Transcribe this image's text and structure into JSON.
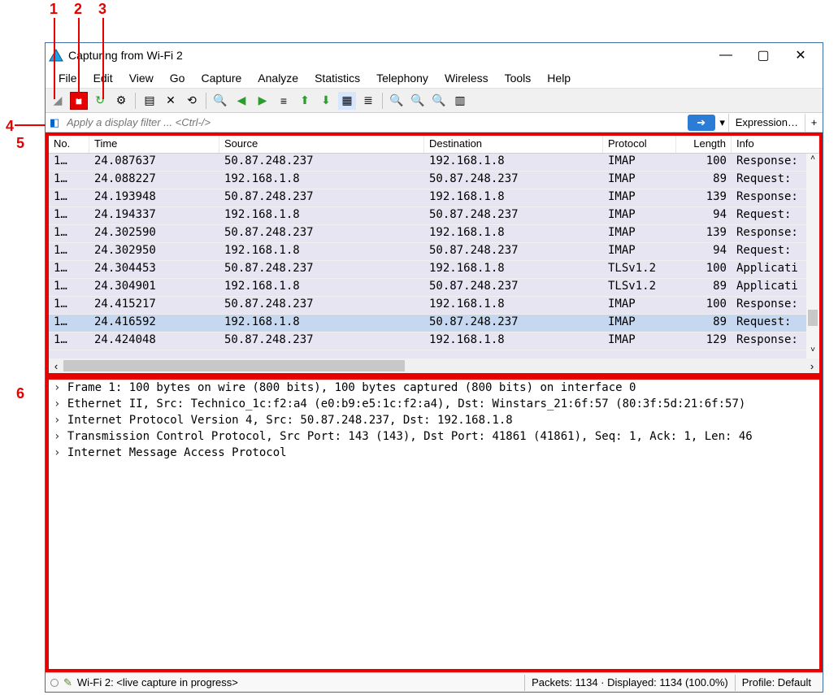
{
  "annotations": {
    "n1": "1",
    "n2": "2",
    "n3": "3",
    "n4": "4",
    "n5": "5",
    "n6": "6"
  },
  "window": {
    "title": "Capturing from Wi-Fi 2"
  },
  "win_controls": {
    "min": "—",
    "max": "▢",
    "close": "✕"
  },
  "menu": {
    "file": "File",
    "edit": "Edit",
    "view": "View",
    "go": "Go",
    "capture": "Capture",
    "analyze": "Analyze",
    "statistics": "Statistics",
    "telephony": "Telephony",
    "wireless": "Wireless",
    "tools": "Tools",
    "help": "Help"
  },
  "toolbar_icons": {
    "start": "◢",
    "stop": "■",
    "restart": "↻",
    "options": "⚙",
    "open": "▤",
    "save": "✕",
    "close": "⟲",
    "find": "🔍",
    "prev": "◀",
    "next": "▶",
    "jump": "≡",
    "first": "⬆",
    "last": "⬇",
    "autoscroll": "▦",
    "colorize": "≣",
    "zoomin": "🔍",
    "zoomout": "🔍",
    "zoomreset": "🔍",
    "resize": "▥"
  },
  "filter": {
    "placeholder": "Apply a display filter ... <Ctrl-/>",
    "apply_arrow": "➔",
    "dropdown": "▾",
    "expression": "Expression…",
    "plus": "+"
  },
  "pkt_headers": {
    "no": "No.",
    "time": "Time",
    "source": "Source",
    "destination": "Destination",
    "protocol": "Protocol",
    "length": "Length",
    "info": "Info"
  },
  "packets": [
    {
      "no": "1…",
      "time": "24.087637",
      "src": "50.87.248.237",
      "dst": "192.168.1.8",
      "proto": "IMAP",
      "len": "100",
      "info": "Response:"
    },
    {
      "no": "1…",
      "time": "24.088227",
      "src": "192.168.1.8",
      "dst": "50.87.248.237",
      "proto": "IMAP",
      "len": "89",
      "info": "Request:"
    },
    {
      "no": "1…",
      "time": "24.193948",
      "src": "50.87.248.237",
      "dst": "192.168.1.8",
      "proto": "IMAP",
      "len": "139",
      "info": "Response:"
    },
    {
      "no": "1…",
      "time": "24.194337",
      "src": "192.168.1.8",
      "dst": "50.87.248.237",
      "proto": "IMAP",
      "len": "94",
      "info": "Request:"
    },
    {
      "no": "1…",
      "time": "24.302590",
      "src": "50.87.248.237",
      "dst": "192.168.1.8",
      "proto": "IMAP",
      "len": "139",
      "info": "Response:"
    },
    {
      "no": "1…",
      "time": "24.302950",
      "src": "192.168.1.8",
      "dst": "50.87.248.237",
      "proto": "IMAP",
      "len": "94",
      "info": "Request:"
    },
    {
      "no": "1…",
      "time": "24.304453",
      "src": "50.87.248.237",
      "dst": "192.168.1.8",
      "proto": "TLSv1.2",
      "len": "100",
      "info": "Applicati"
    },
    {
      "no": "1…",
      "time": "24.304901",
      "src": "192.168.1.8",
      "dst": "50.87.248.237",
      "proto": "TLSv1.2",
      "len": "89",
      "info": "Applicati"
    },
    {
      "no": "1…",
      "time": "24.415217",
      "src": "50.87.248.237",
      "dst": "192.168.1.8",
      "proto": "IMAP",
      "len": "100",
      "info": "Response:"
    },
    {
      "no": "1…",
      "time": "24.416592",
      "src": "192.168.1.8",
      "dst": "50.87.248.237",
      "proto": "IMAP",
      "len": "89",
      "info": "Request:",
      "selected": true
    },
    {
      "no": "1…",
      "time": "24.424048",
      "src": "50.87.248.237",
      "dst": "192.168.1.8",
      "proto": "IMAP",
      "len": "129",
      "info": "Response:"
    }
  ],
  "scroll": {
    "left": "‹",
    "right": "›",
    "up": "˄",
    "down": "˅"
  },
  "details": [
    "Frame 1: 100 bytes on wire (800 bits), 100 bytes captured (800 bits) on interface 0",
    "Ethernet II, Src: Technico_1c:f2:a4 (e0:b9:e5:1c:f2:a4), Dst: Winstars_21:6f:57 (80:3f:5d:21:6f:57)",
    "Internet Protocol Version 4, Src: 50.87.248.237, Dst: 192.168.1.8",
    "Transmission Control Protocol, Src Port: 143 (143), Dst Port: 41861 (41861), Seq: 1, Ack: 1, Len: 46",
    "Internet Message Access Protocol"
  ],
  "status": {
    "edit_note": "✎",
    "iface": "Wi-Fi 2: <live capture in progress>",
    "packets": "Packets: 1134 · Displayed: 1134 (100.0%)",
    "profile": "Profile: Default"
  }
}
